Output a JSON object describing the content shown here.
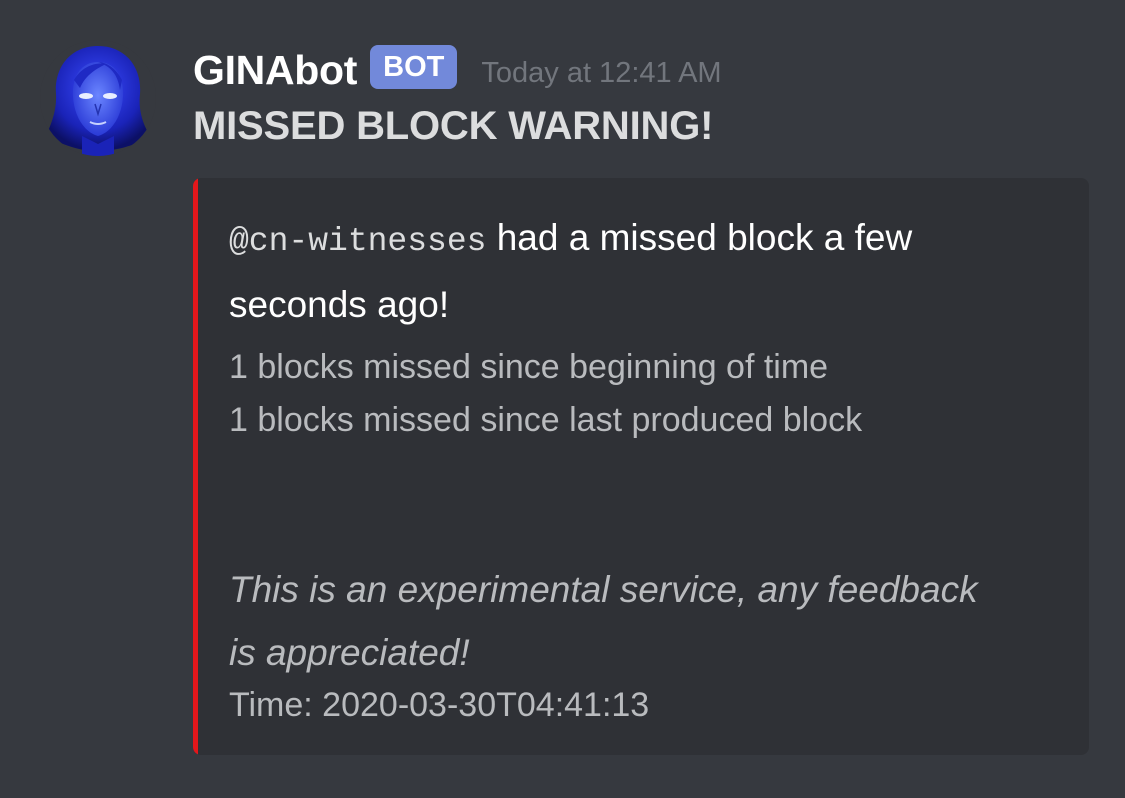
{
  "message": {
    "author": "GINAbot",
    "badge": "BOT",
    "timestamp": "Today at 12:41 AM",
    "content": "MISSED BLOCK WARNING!",
    "avatar_icon": "bot-avatar-icon"
  },
  "embed": {
    "accent_color": "#e3171b",
    "mention": "@cn-witnesses",
    "description_text": " had a missed block a few seconds ago!",
    "lines": [
      "1 blocks missed since beginning of time",
      "1 blocks missed since last produced block"
    ],
    "note": "This is an experimental service, any feedback is appreciated!",
    "time_line": "Time: 2020-03-30T04:41:13"
  }
}
